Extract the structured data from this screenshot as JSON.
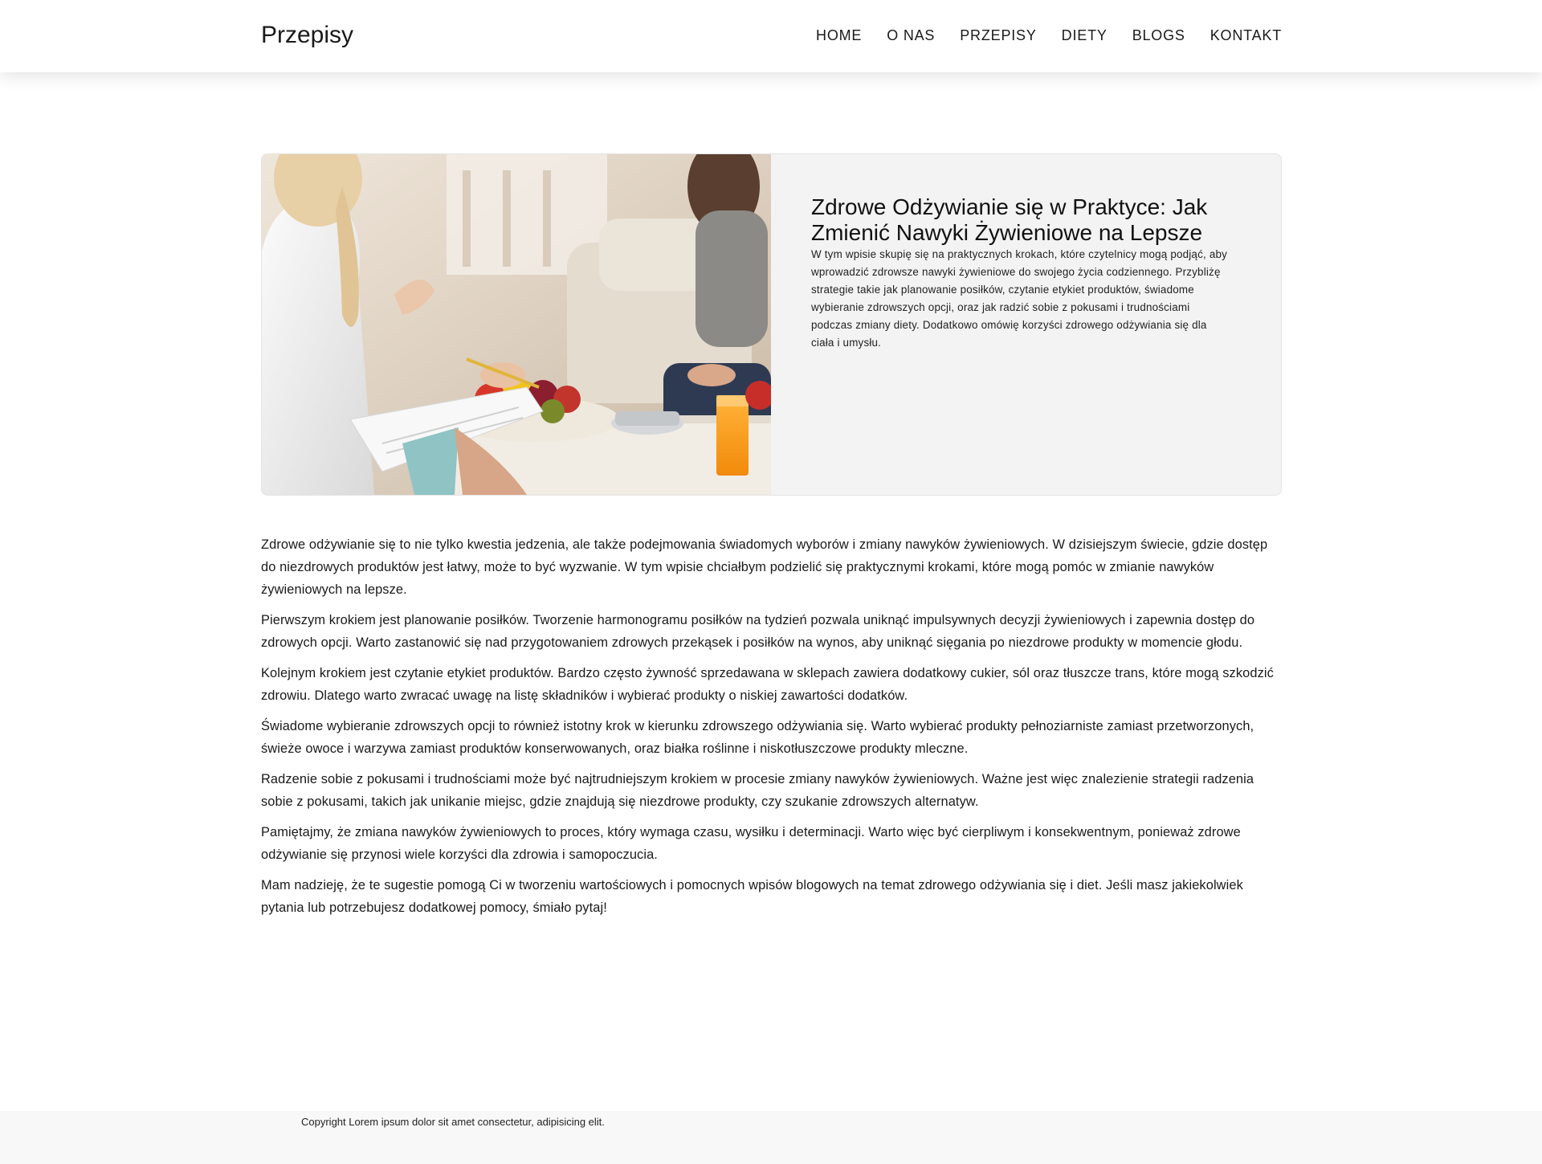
{
  "header": {
    "brand": "Przepisy",
    "nav": [
      "HOME",
      "O NAS",
      "PRZEPISY",
      "DIETY",
      "BLOGS",
      "KONTAKT"
    ]
  },
  "hero": {
    "image_alt": "nutrition-consultation-photo",
    "title": "Zdrowe Odżywianie się w Praktyce: Jak Zmienić Nawyki Żywieniowe na Lepsze",
    "excerpt": "W tym wpisie skupię się na praktycznych krokach, które czytelnicy mogą podjąć, aby wprowadzić zdrowsze nawyki żywieniowe do swojego życia codziennego. Przybliżę strategie takie jak planowanie posiłków, czytanie etykiet produktów, świadome wybieranie zdrowszych opcji, oraz jak radzić sobie z pokusami i trudnościami podczas zmiany diety. Dodatkowo omówię korzyści zdrowego odżywiania się dla ciała i umysłu."
  },
  "article": {
    "paragraphs": [
      "Zdrowe odżywianie się to nie tylko kwestia jedzenia, ale także podejmowania świadomych wyborów i zmiany nawyków żywieniowych. W dzisiejszym świecie, gdzie dostęp do niezdrowych produktów jest łatwy, może to być wyzwanie. W tym wpisie chciałbym podzielić się praktycznymi krokami, które mogą pomóc w zmianie nawyków żywieniowych na lepsze.",
      "Pierwszym krokiem jest planowanie posiłków. Tworzenie harmonogramu posiłków na tydzień pozwala uniknąć impulsywnych decyzji żywieniowych i zapewnia dostęp do zdrowych opcji. Warto zastanowić się nad przygotowaniem zdrowych przekąsek i posiłków na wynos, aby uniknąć sięgania po niezdrowe produkty w momencie głodu.",
      "Kolejnym krokiem jest czytanie etykiet produktów. Bardzo często żywność sprzedawana w sklepach zawiera dodatkowy cukier, sól oraz tłuszcze trans, które mogą szkodzić zdrowiu. Dlatego warto zwracać uwagę na listę składników i wybierać produkty o niskiej zawartości dodatków.",
      "Świadome wybieranie zdrowszych opcji to również istotny krok w kierunku zdrowszego odżywiania się. Warto wybierać produkty pełnoziarniste zamiast przetworzonych, świeże owoce i warzywa zamiast produktów konserwowanych, oraz białka roślinne i niskotłuszczowe produkty mleczne.",
      "Radzenie sobie z pokusami i trudnościami może być najtrudniejszym krokiem w procesie zmiany nawyków żywieniowych. Ważne jest więc znalezienie strategii radzenia sobie z pokusami, takich jak unikanie miejsc, gdzie znajdują się niezdrowe produkty, czy szukanie zdrowszych alternatyw.",
      "Pamiętajmy, że zmiana nawyków żywieniowych to proces, który wymaga czasu, wysiłku i determinacji. Warto więc być cierpliwym i konsekwentnym, ponieważ zdrowe odżywianie się przynosi wiele korzyści dla zdrowia i samopoczucia.",
      "Mam nadzieję, że te sugestie pomogą Ci w tworzeniu wartościowych i pomocnych wpisów blogowych na temat zdrowego odżywiania się i diet. Jeśli masz jakiekolwiek pytania lub potrzebujesz dodatkowej pomocy, śmiało pytaj!"
    ]
  },
  "footer": {
    "copyright": "Copyright Lorem ipsum dolor sit amet consectetur, adipisicing elit."
  }
}
